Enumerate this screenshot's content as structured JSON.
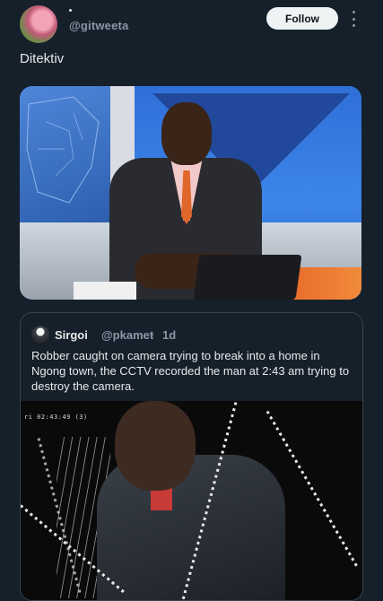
{
  "post": {
    "handle": "@gitweeta",
    "follow_label": "Follow",
    "text": "Ditektiv"
  },
  "quote": {
    "name": "Sirgoi",
    "handle": "@pkamet",
    "separator": "·",
    "time": "1d",
    "text": "Robber caught on camera trying to break into a home in Ngong town, the CCTV  recorded the man at 2:43 am trying to destroy the camera.",
    "cctv_timestamp": "ri 02:43:49 (3)"
  },
  "colors": {
    "background": "#15202b",
    "text": "#e7e9ea",
    "muted": "#8b98a5",
    "border": "#38444d",
    "follow_bg": "#eff3f4"
  },
  "icons": [
    "more-icon"
  ]
}
